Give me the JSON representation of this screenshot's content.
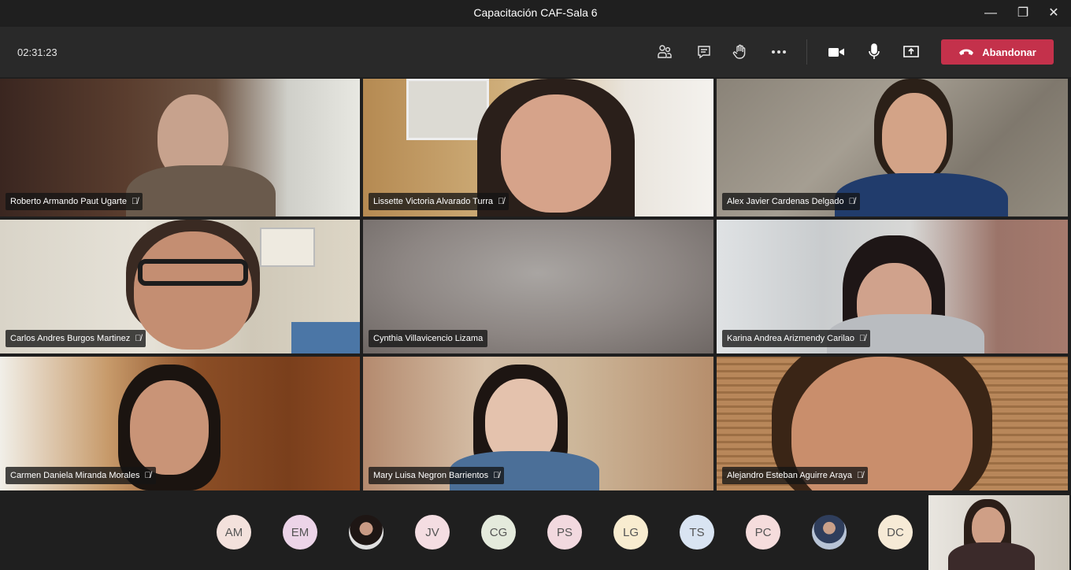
{
  "window": {
    "title": "Capacitación CAF-Sala 6",
    "minimize_glyph": "—",
    "restore_glyph": "❐",
    "close_glyph": "✕"
  },
  "toolbar": {
    "timer": "02:31:23",
    "leave_label": "Abandonar",
    "icons": [
      "participants-icon",
      "chat-icon",
      "raise-hand-icon",
      "more-options-icon",
      "camera-icon",
      "microphone-icon",
      "share-screen-icon"
    ]
  },
  "participants": [
    {
      "name": "Roberto Armando Paut Ugarte",
      "muted": true
    },
    {
      "name": "Lissette Victoria Alvarado Turra",
      "muted": true
    },
    {
      "name": "Alex Javier Cardenas Delgado",
      "muted": true
    },
    {
      "name": "Carlos Andres Burgos Martinez",
      "muted": true
    },
    {
      "name": "Cynthia Villavicencio Lizama",
      "muted": false
    },
    {
      "name": "Karina Andrea Arizmendy Carilao",
      "muted": true
    },
    {
      "name": "Carmen Daniela Miranda Morales",
      "muted": true
    },
    {
      "name": "Mary Luisa Negron Barrientos",
      "muted": true
    },
    {
      "name": "Alejandro Esteban Aguirre Araya",
      "muted": true
    }
  ],
  "overflow_avatars": [
    {
      "initials": "AM",
      "color": "#f3e1dc"
    },
    {
      "initials": "EM",
      "color": "#ecd4e8"
    },
    {
      "initials": "",
      "color": "#d8d8d8",
      "photo": true
    },
    {
      "initials": "JV",
      "color": "#f4dde2"
    },
    {
      "initials": "CG",
      "color": "#e4eadc"
    },
    {
      "initials": "PS",
      "color": "#f2d9df"
    },
    {
      "initials": "LG",
      "color": "#f8ecd0"
    },
    {
      "initials": "TS",
      "color": "#d9e4f2"
    },
    {
      "initials": "PC",
      "color": "#f5dcdc"
    },
    {
      "initials": "",
      "color": "#c8ccd2",
      "photo": true
    },
    {
      "initials": "DC",
      "color": "#f6ead6"
    }
  ]
}
